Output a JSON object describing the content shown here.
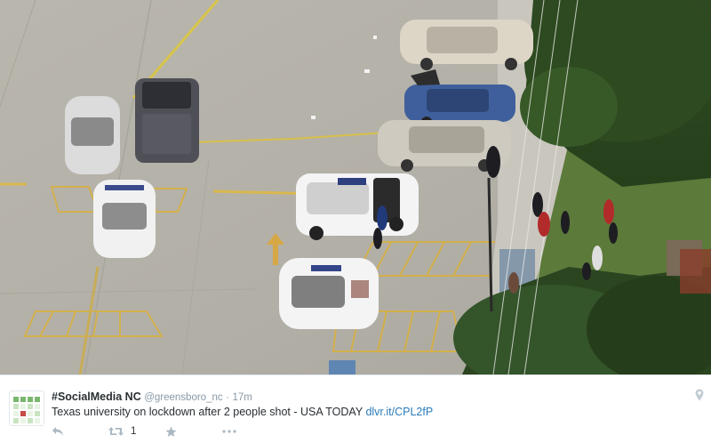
{
  "tweet": {
    "author_name": "#SocialMedia NC",
    "handle": "@greensboro_nc",
    "separator": "·",
    "time": "17m",
    "text": "Texas university on lockdown after 2 people shot - USA TODAY ",
    "link": "dlvr.it/CPL2fP",
    "retweet_count": "1"
  },
  "icons": {
    "reply": "reply-icon",
    "retweet": "retweet-icon",
    "favorite": "star-icon",
    "more": "more-icon",
    "location": "location-pin-icon"
  },
  "colors": {
    "link": "#2b7bb9",
    "muted": "#8899a6",
    "action": "#aab8c2",
    "text": "#292f33"
  }
}
